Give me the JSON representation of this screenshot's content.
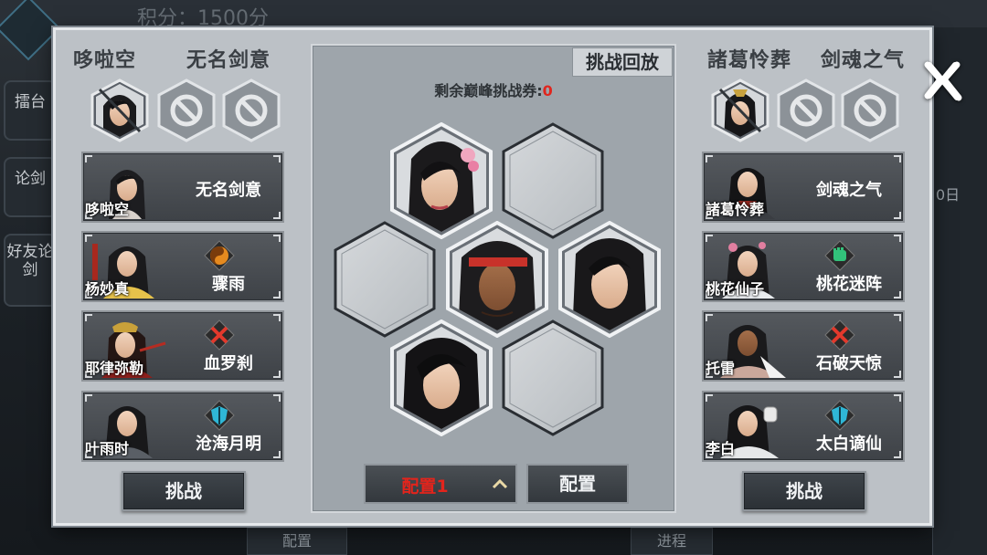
{
  "background": {
    "score_text": "积分：1500分",
    "side_items": [
      "擂台",
      "论剑",
      "好友论剑"
    ],
    "right_text": "0日",
    "bottom_labels": [
      "配置",
      "进程"
    ]
  },
  "left_team": {
    "header": [
      "哆啦空",
      "无名剑意"
    ],
    "challenge_label": "挑战",
    "cards": [
      {
        "hero": "哆啦空",
        "skill": "无名剑意",
        "skill_icon": "none"
      },
      {
        "hero": "杨妙真",
        "skill": "骤雨",
        "skill_icon": "orange-yinyang-icon"
      },
      {
        "hero": "耶律弥勒",
        "skill": "血罗刹",
        "skill_icon": "red-crossed-swords-icon"
      },
      {
        "hero": "叶雨时",
        "skill": "沧海月明",
        "skill_icon": "cyan-shield-icon"
      }
    ]
  },
  "right_team": {
    "header": [
      "諸葛怜葬",
      "剑魂之气"
    ],
    "challenge_label": "挑战",
    "cards": [
      {
        "hero": "諸葛怜葬",
        "skill": "剑魂之气",
        "skill_icon": "none"
      },
      {
        "hero": "桃花仙子",
        "skill": "桃花迷阵",
        "skill_icon": "green-fist-icon"
      },
      {
        "hero": "托雷",
        "skill": "石破天惊",
        "skill_icon": "red-crossed-swords-icon"
      },
      {
        "hero": "李白",
        "skill": "太白谪仙",
        "skill_icon": "cyan-shield-icon"
      }
    ]
  },
  "center": {
    "replay_label": "挑战回放",
    "ticket_label": "剩余巅峰挑战券:",
    "ticket_count": "0",
    "config_value": "配置1",
    "config_label": "配置",
    "formation": [
      "hero-a",
      "empty",
      "empty",
      "hero-b",
      "hero-c",
      "hero-d",
      "empty"
    ]
  },
  "colors": {
    "accent_red": "#e0261e",
    "panel_bg": "#bcc1c6",
    "card_bg": "#45494e"
  }
}
